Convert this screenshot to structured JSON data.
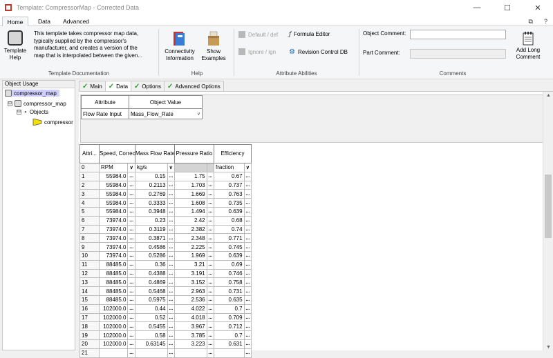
{
  "window": {
    "title": "Template: CompressorMap - Corrected Data",
    "controls": [
      "—",
      "☐",
      "✕"
    ]
  },
  "ribbon_tabs": [
    {
      "label": "Home",
      "active": true
    },
    {
      "label": "Data",
      "active": false
    },
    {
      "label": "Advanced",
      "active": false
    }
  ],
  "tab_icons": [
    "⧉",
    "?"
  ],
  "ribbon": {
    "template_doc": {
      "help_label": "Template Help",
      "description_lines": [
        "This template takes compressor map data,",
        "typically supplied by the compressor's",
        "manufacturer, and creates a version of the",
        "map that is interpolated between the given..."
      ],
      "group_label": "Template Documentation"
    },
    "help_group": {
      "connectivity_label": "Connectivity Information",
      "examples_label": "Show Examples",
      "group_label": "Help"
    },
    "attr_group": {
      "default_label": "Default / def",
      "ignore_label": "Ignore / ign",
      "formula_label": "Formula Editor",
      "revision_label": "Revision Control DB",
      "group_label": "Attribute Abilities"
    },
    "comments_group": {
      "object_comment_label": "Object Comment:",
      "object_comment_value": "",
      "part_comment_label": "Part Comment:",
      "part_comment_value": "",
      "add_long_label": "Add Long Comment",
      "group_label": "Comments"
    }
  },
  "left_pane": {
    "header": "Object Usage",
    "items": [
      {
        "label": "compressor_map",
        "selected": true
      },
      {
        "label": "compressor_map",
        "expander": "⊟"
      },
      {
        "label": "Objects",
        "expander": "⊟"
      },
      {
        "label": "compressor"
      }
    ]
  },
  "sub_tabs": [
    {
      "label": "Main",
      "active": false
    },
    {
      "label": "Data",
      "active": true
    },
    {
      "label": "Options",
      "active": false
    },
    {
      "label": "Advanced Options",
      "active": false
    }
  ],
  "attributes": {
    "headers": [
      "Attribute",
      "Object Value"
    ],
    "rows": [
      {
        "attribute": "Flow Rate Input",
        "value": "Mass_Flow_Rate"
      }
    ]
  },
  "data_table": {
    "headers": [
      "Attri...",
      "Speed, Corrected",
      "Mass Flow Rate, Corrected",
      "Pressure Ratio",
      "Efficiency"
    ],
    "units_row": {
      "index": "0",
      "speed": "RPM",
      "mass": "kg/s",
      "pressure": "",
      "efficiency": "fraction"
    },
    "ellipsis": "...",
    "rows": [
      {
        "i": "1",
        "speed": "55984.0",
        "mass": "0.15",
        "pr": "1.75",
        "eff": "0.67"
      },
      {
        "i": "2",
        "speed": "55984.0",
        "mass": "0.2113",
        "pr": "1.703",
        "eff": "0.737"
      },
      {
        "i": "3",
        "speed": "55984.0",
        "mass": "0.2769",
        "pr": "1.669",
        "eff": "0.763"
      },
      {
        "i": "4",
        "speed": "55984.0",
        "mass": "0.3333",
        "pr": "1.608",
        "eff": "0.735"
      },
      {
        "i": "5",
        "speed": "55984.0",
        "mass": "0.3948",
        "pr": "1.494",
        "eff": "0.639"
      },
      {
        "i": "6",
        "speed": "73974.0",
        "mass": "0.23",
        "pr": "2.42",
        "eff": "0.68"
      },
      {
        "i": "7",
        "speed": "73974.0",
        "mass": "0.3119",
        "pr": "2.382",
        "eff": "0.74"
      },
      {
        "i": "8",
        "speed": "73974.0",
        "mass": "0.3871",
        "pr": "2.348",
        "eff": "0.771"
      },
      {
        "i": "9",
        "speed": "73974.0",
        "mass": "0.4586",
        "pr": "2.225",
        "eff": "0.745"
      },
      {
        "i": "10",
        "speed": "73974.0",
        "mass": "0.5286",
        "pr": "1.969",
        "eff": "0.639"
      },
      {
        "i": "11",
        "speed": "88485.0",
        "mass": "0.36",
        "pr": "3.21",
        "eff": "0.69"
      },
      {
        "i": "12",
        "speed": "88485.0",
        "mass": "0.4388",
        "pr": "3.191",
        "eff": "0.746"
      },
      {
        "i": "13",
        "speed": "88485.0",
        "mass": "0.4869",
        "pr": "3.152",
        "eff": "0.758"
      },
      {
        "i": "14",
        "speed": "88485.0",
        "mass": "0.5468",
        "pr": "2.963",
        "eff": "0.731"
      },
      {
        "i": "15",
        "speed": "88485.0",
        "mass": "0.5975",
        "pr": "2.536",
        "eff": "0.635"
      },
      {
        "i": "16",
        "speed": "102000.0",
        "mass": "0.44",
        "pr": "4.022",
        "eff": "0.7"
      },
      {
        "i": "17",
        "speed": "102000.0",
        "mass": "0.52",
        "pr": "4.018",
        "eff": "0.709"
      },
      {
        "i": "18",
        "speed": "102000.0",
        "mass": "0.5455",
        "pr": "3.967",
        "eff": "0.712"
      },
      {
        "i": "19",
        "speed": "102000.0",
        "mass": "0.58",
        "pr": "3.785",
        "eff": "0.7"
      },
      {
        "i": "20",
        "speed": "102000.0",
        "mass": "0.63145",
        "pr": "3.223",
        "eff": "0.631"
      },
      {
        "i": "21",
        "speed": "",
        "mass": "",
        "pr": "",
        "eff": ""
      }
    ]
  },
  "colors": {
    "active_tab": "#1e6fc0",
    "selected_item": "#cfcfff",
    "check": "#2a9d2a"
  }
}
